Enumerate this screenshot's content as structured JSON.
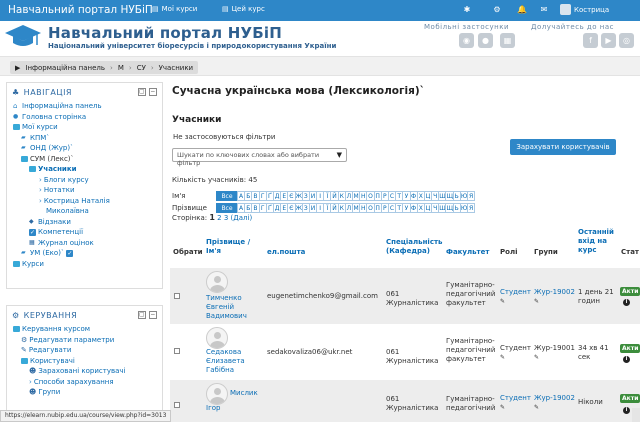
{
  "topnav": {
    "brand": "Навчальний портал НУБіП",
    "my_courses": "Мої курси",
    "this_course": "Цей курс",
    "user_name": "Кострица"
  },
  "header": {
    "title": "Навчальний портал НУБіП",
    "subtitle": "Національний університет біоресурсів і природокористування України",
    "mobile_apps": "Мобільні застосунки",
    "join_us": "Долучайтесь до нас"
  },
  "breadcrumb": [
    "Інформаційна панель",
    "М",
    "СУ",
    "Учасники"
  ],
  "navigation": {
    "title": "НАВІГАЦІЯ",
    "items": [
      {
        "label": "Інформаційна панель"
      },
      {
        "label": "Головна сторінка"
      },
      {
        "label": "Мої курси"
      },
      {
        "label": "КПМ`"
      },
      {
        "label": "ОНД (Жур)`"
      },
      {
        "label": "СУМ (Лекс)`"
      },
      {
        "label": "Учасники"
      },
      {
        "label": "Блоги курсу"
      },
      {
        "label": "Нотатки"
      },
      {
        "label": "Кострица Наталія"
      },
      {
        "label": "Миколаївна"
      },
      {
        "label": "Відзнаки"
      },
      {
        "label": "Компетенції"
      },
      {
        "label": "Журнал оцінок"
      },
      {
        "label": "УМ (Еко)`"
      },
      {
        "label": "Курси"
      }
    ]
  },
  "admin": {
    "title": "КЕРУВАННЯ",
    "items": [
      {
        "label": "Керування курсом"
      },
      {
        "label": "Редагувати параметри"
      },
      {
        "label": "Редагувати"
      },
      {
        "label": "Користувачі"
      },
      {
        "label": "Зараховані користувачі"
      },
      {
        "label": "Способи зарахування"
      },
      {
        "label": "Групи"
      }
    ]
  },
  "main": {
    "course_title": "Сучасна українська мова (Лексикологія)`",
    "section": "Учасники",
    "no_filters": "Не застосовуються фільтри",
    "search_placeholder": "Шукати по ключових словах або вибрати фільтр",
    "enrol_button": "Зарахувати користувачів",
    "count_label": "Кількість учасників: 45",
    "firstname_label": "Ім'я",
    "surname_label": "Прізвище",
    "all_label": "Все",
    "letters": [
      "А",
      "Б",
      "В",
      "Г",
      "Ґ",
      "Д",
      "Е",
      "Є",
      "Ж",
      "З",
      "И",
      "І",
      "Ї",
      "Й",
      "К",
      "Л",
      "М",
      "Н",
      "О",
      "П",
      "Р",
      "С",
      "Т",
      "У",
      "Ф",
      "Х",
      "Ц",
      "Ч",
      "Ш",
      "Щ",
      "Ь",
      "Ю",
      "Я"
    ],
    "page_label": "Сторінка:",
    "page_current": "1",
    "page_2": "2",
    "page_3": "3",
    "page_next": "(Далі)"
  },
  "table": {
    "headers": {
      "select": "Обрати",
      "name_1": "Прізвище /",
      "name_2": "Ім'я",
      "email": "ел.пошта",
      "spec_1": "Спеціальність",
      "spec_2": "(Кафедра)",
      "faculty": "Факультет",
      "roles": "Ролі",
      "groups": "Групи",
      "last_1": "Останній",
      "last_2": "вхід на",
      "last_3": "курс",
      "status": "Стат"
    },
    "rows": [
      {
        "name_1": "Тимченко",
        "name_2": "Євгеній",
        "name_3": "Вадимович",
        "email": "eugenetimchenko9@gmail.com",
        "spec_1": "061",
        "spec_2": "Журналістика",
        "fac_1": "Гуманітарно-",
        "fac_2": "педагогічний",
        "fac_3": "факультет",
        "role": "Студент",
        "group": "Жур-19002",
        "last_1": "1 день 21",
        "last_2": "годин",
        "status": "Акти"
      },
      {
        "name_1": "Седакова",
        "name_2": "Єлизавета",
        "name_3": "Габібна",
        "email": "sedakovaliza06@ukr.net",
        "spec_1": "061",
        "spec_2": "Журналістика",
        "fac_1": "Гуманітарно-",
        "fac_2": "педагогічний",
        "fac_3": "факультет",
        "role": "Студент",
        "group": "Жур-19001",
        "last_1": "34 хв 41",
        "last_2": "сек",
        "status": "Акти"
      },
      {
        "name_1": "Мислик",
        "name_2": "Ігор",
        "name_3": "",
        "email": "",
        "spec_1": "061",
        "spec_2": "Журналістика",
        "fac_1": "Гуманітарно-",
        "fac_2": "педагогічний",
        "fac_3": "",
        "role": "Студент",
        "group": "Жур-19002",
        "last_1": "Ніколи",
        "last_2": "",
        "status": "Акти"
      }
    ]
  },
  "statusbar": "https://elearn.nubip.edu.ua/course/view.php?id=3013",
  "colors": {
    "topbar": "#2e87c8",
    "brand_text": "#2e5f8f",
    "link": "#0a6db5",
    "active_badge": "#3c8d3c"
  }
}
